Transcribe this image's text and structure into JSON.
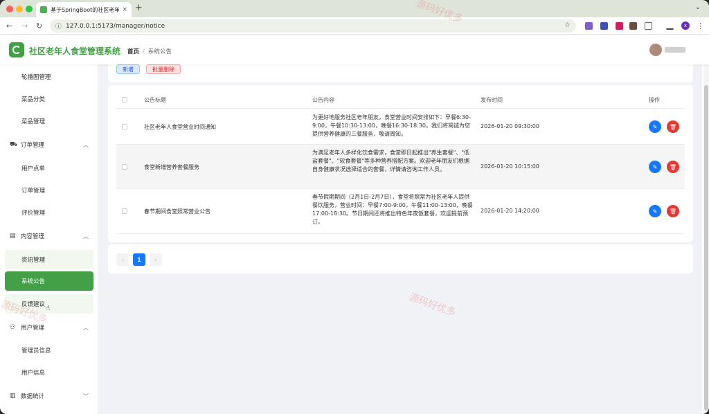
{
  "browser": {
    "tab_title": "基于SpringBoot的社区老年人食堂",
    "tab_close": "×",
    "new_tab": "+",
    "url": "127.0.0.1:5173/manager/notice",
    "profile_initial": "x"
  },
  "header": {
    "app_title": "社区老年人食堂管理系统",
    "breadcrumb_home": "首页",
    "breadcrumb_sep": "/",
    "breadcrumb_current": "系统公告"
  },
  "sidebar": {
    "items": [
      {
        "label": "轮播图管理"
      },
      {
        "label": "菜品分类"
      },
      {
        "label": "菜品管理"
      }
    ],
    "group_order": {
      "label": "订单管理",
      "icon": "cart-icon"
    },
    "order_items": [
      {
        "label": "用户点单"
      },
      {
        "label": "订单管理"
      },
      {
        "label": "评价管理"
      }
    ],
    "group_content": {
      "label": "内容管理",
      "icon": "document-icon"
    },
    "content_items": [
      {
        "label": "资讯管理"
      },
      {
        "label": "系统公告"
      },
      {
        "label": "反馈建议"
      }
    ],
    "group_user": {
      "label": "用户管理",
      "icon": "user-icon"
    },
    "user_items": [
      {
        "label": "管理员信息"
      },
      {
        "label": "用户信息"
      }
    ],
    "group_stats": {
      "label": "数据统计",
      "icon": "chart-icon"
    }
  },
  "toolbar": {
    "add_label": "新增",
    "batch_delete_label": "批量删除"
  },
  "table": {
    "headers": {
      "title": "公告标题",
      "content": "公告内容",
      "time": "发布时间",
      "actions": "操作"
    },
    "rows": [
      {
        "title": "社区老年人食堂营业时间通知",
        "content": "为更好地服务社区老年朋友，食堂营业时间安排如下：早餐6:30-9:00，午餐10:30-13:00，晚餐16:30-18:30。我们将竭诚为您提供营养健康的三餐服务，敬请周知。",
        "time": "2026-01-20 09:30:00"
      },
      {
        "title": "食堂新增营养套餐服务",
        "content": "为满足老年人多样化饮食需求，食堂即日起推出\"养生套餐\"、\"低盐套餐\"、\"软食套餐\"等多种营养搭配方案。欢迎老年朋友们根据自身健康状况选择适合的套餐，详情请咨询工作人员。",
        "time": "2026-01-20 10:15:00"
      },
      {
        "title": "春节期间食堂照常营业公告",
        "content": "春节假期期间（2月1日-2月7日），食堂将照常为社区老年人提供餐饮服务，营业时间：早餐7:00-9:00，午餐11:00-13:00，晚餐17:00-18:30。节日期间还将推出特色年夜饭套餐，欢迎提前预订。",
        "time": "2026-01-20 14:20:00"
      }
    ]
  },
  "pager": {
    "prev": "‹",
    "current": "1",
    "next": "›"
  },
  "watermark": "源码好优多",
  "colors": {
    "brand": "#43a047",
    "primary": "#1677ff",
    "danger": "#e53935"
  }
}
